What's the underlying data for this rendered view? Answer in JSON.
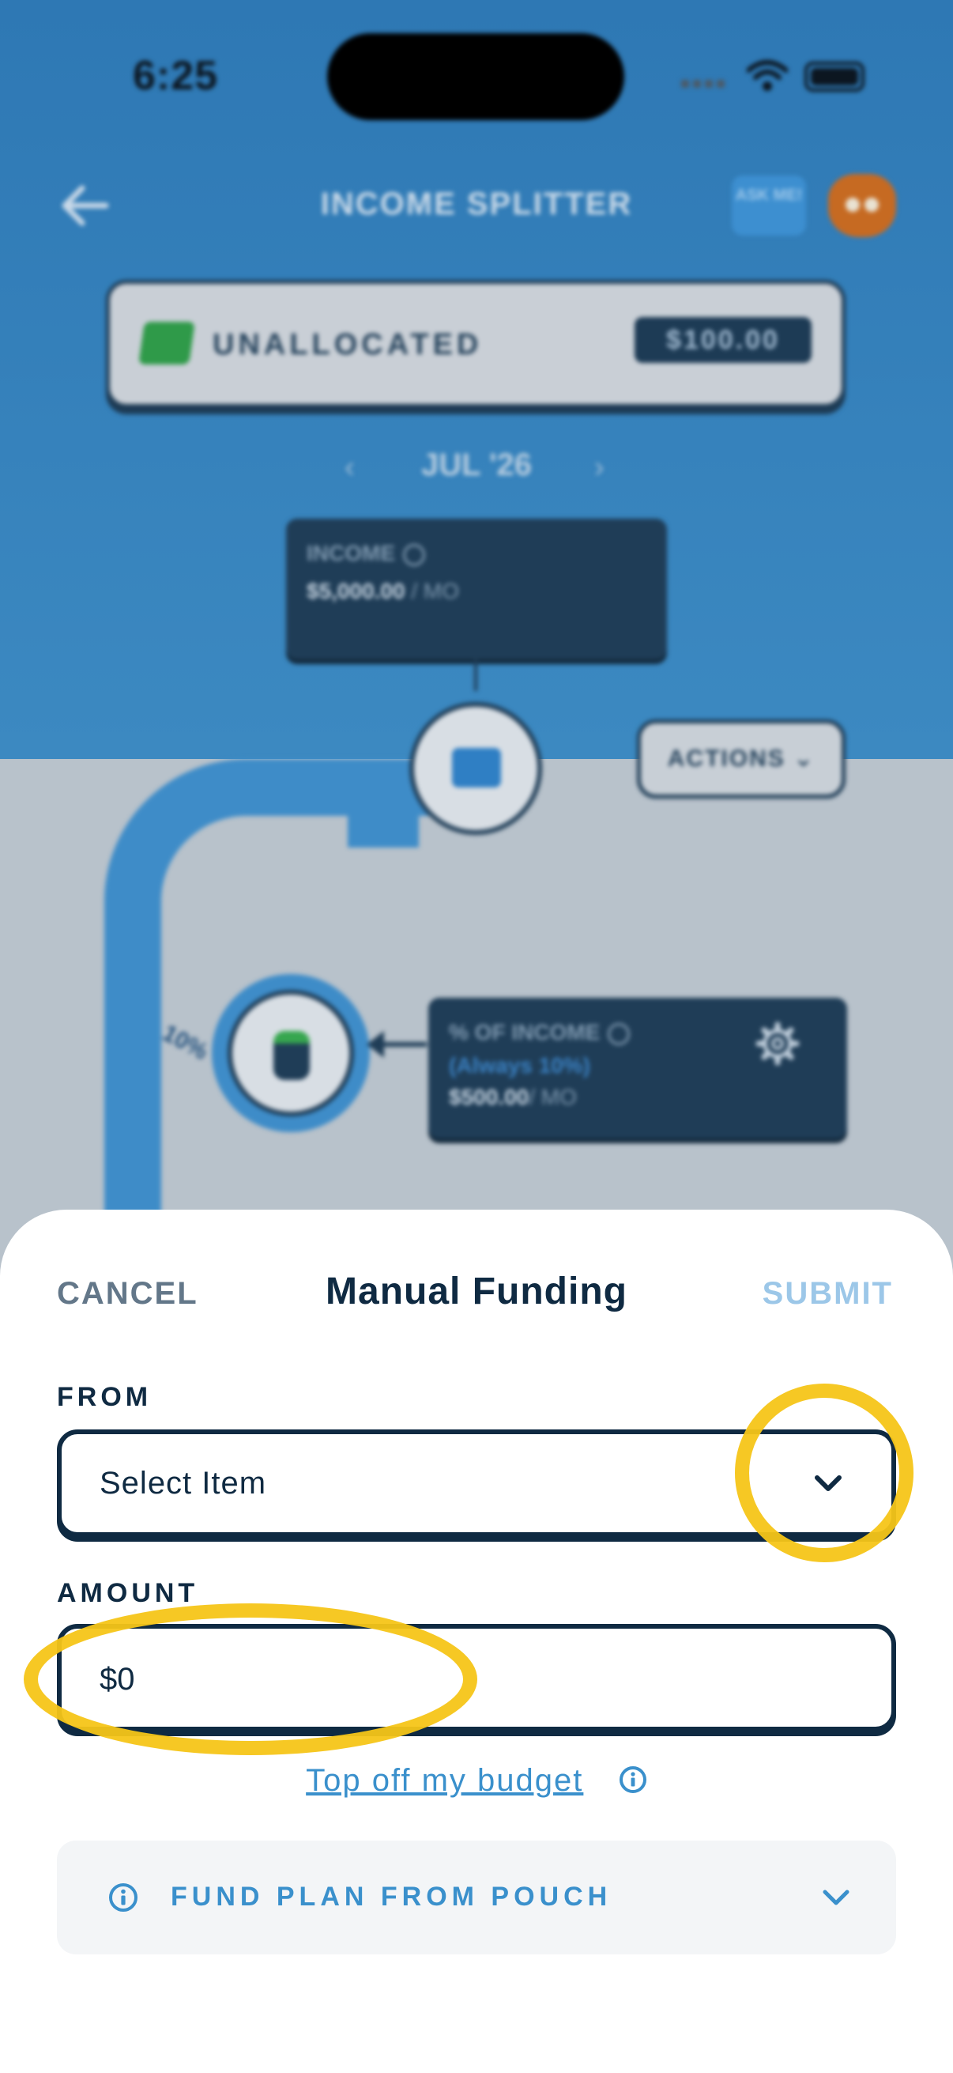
{
  "status_bar": {
    "time": "6:25"
  },
  "header": {
    "title": "INCOME SPLITTER",
    "ask_me": "ASK ME!"
  },
  "unallocated": {
    "label": "UNALLOCATED",
    "amount": "$100.00"
  },
  "month": {
    "label": "JUL '26",
    "prev": "‹",
    "next": "›"
  },
  "income_node": {
    "label": "INCOME",
    "value": "$5,000.00",
    "unit": " / MO"
  },
  "actions": {
    "label": "ACTIONS ⌄"
  },
  "percent_node": {
    "label": "% OF INCOME",
    "rule": "(Always 10%)",
    "value": "$500.00",
    "unit": "/ MO",
    "pipe_label": "10%"
  },
  "sheet": {
    "cancel": "CANCEL",
    "title": "Manual Funding",
    "submit": "SUBMIT",
    "from_label": "FROM",
    "from_value": "Select Item",
    "amount_label": "AMOUNT",
    "amount_value": "$0",
    "top_off_link": "Top off my budget",
    "fund_plan_label": "FUND PLAN FROM POUCH"
  },
  "colors": {
    "primary_dark": "#0f2a42",
    "accent_blue": "#3a90cc",
    "submit_disabled": "#9cc7e8",
    "highlight": "#f5c518"
  }
}
